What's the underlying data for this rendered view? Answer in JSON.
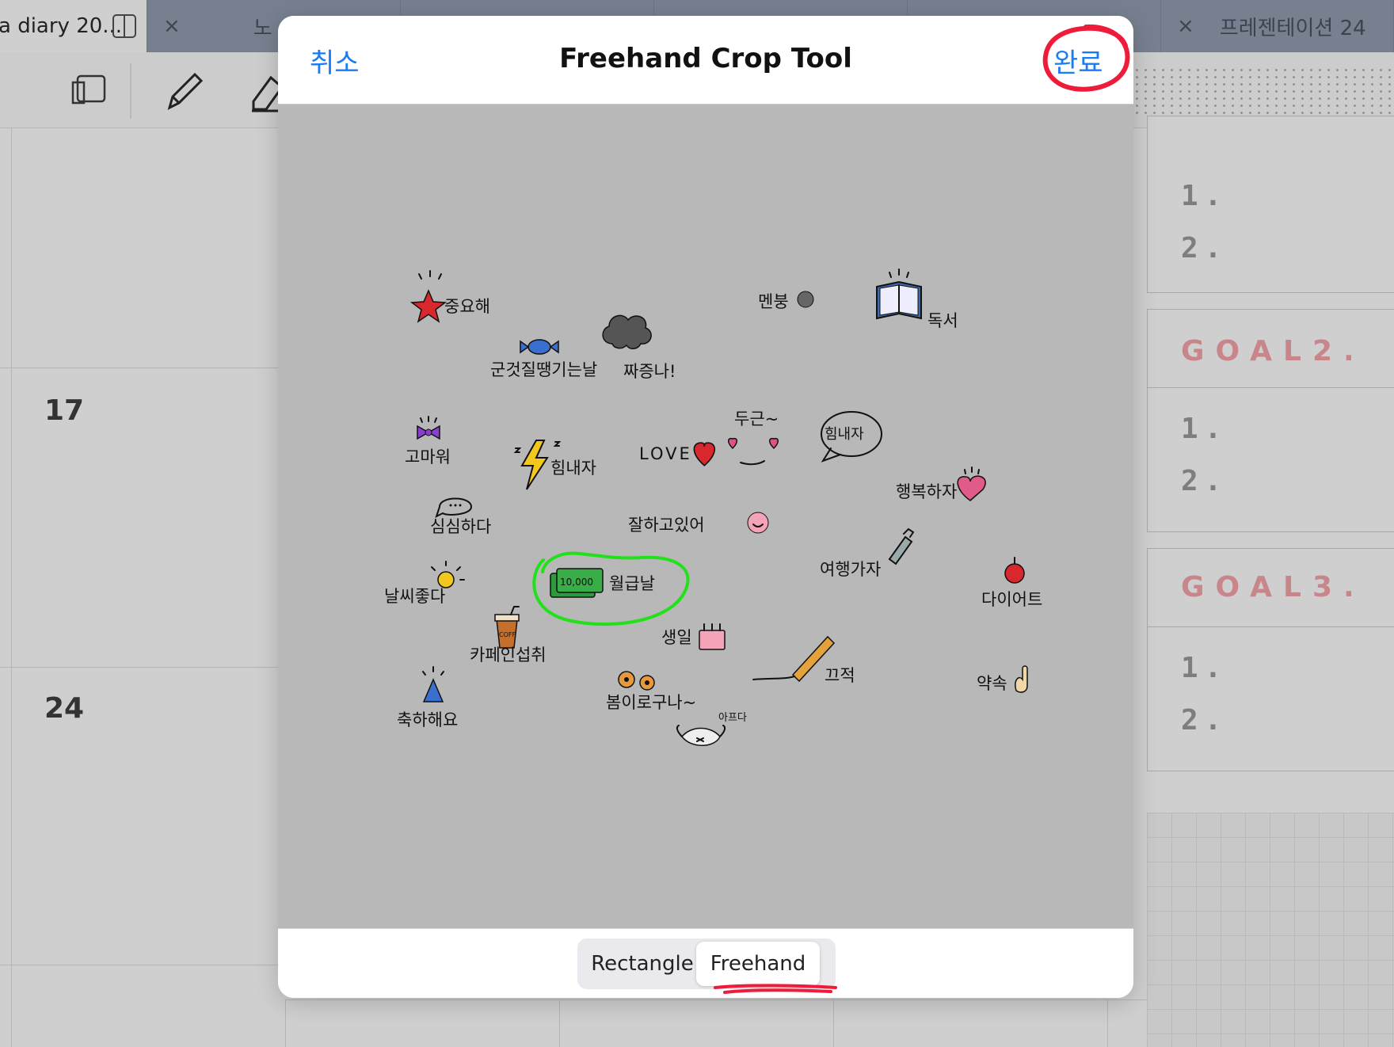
{
  "tabs": [
    {
      "label": "a diary 20...",
      "active": true
    },
    {
      "label": "노",
      "active": false
    },
    {
      "label": "",
      "active": false
    },
    {
      "label": "",
      "active": false
    },
    {
      "label": "",
      "active": false
    },
    {
      "label": "프레젠테이션 24",
      "active": false
    }
  ],
  "tab_close_glyph": "×",
  "toolbar_icons": [
    "page-layout-icon",
    "pencil-icon",
    "eraser-icon"
  ],
  "calendar": {
    "days": [
      "17",
      "24"
    ]
  },
  "goals": {
    "goal2_title": "GOAL2.",
    "goal3_title": "GOAL3.",
    "item1": "1.",
    "item2": "2."
  },
  "modal": {
    "title": "Freehand Crop Tool",
    "cancel_label": "취소",
    "done_label": "완료",
    "modes": [
      "Rectangle",
      "Freehand"
    ],
    "selected_mode": "Freehand"
  },
  "stickers": [
    {
      "text": "중요해",
      "icon": "star-icon"
    },
    {
      "text": "군것질땡기는날",
      "icon": "candy-icon"
    },
    {
      "text": "짜증나!",
      "icon": "cloud-icon"
    },
    {
      "text": "멘붕",
      "icon": "smoke-icon"
    },
    {
      "text": "독서",
      "icon": "book-icon"
    },
    {
      "text": "고마워",
      "icon": "ribbon-icon"
    },
    {
      "text": "힘내자",
      "icon": "lightning-icon"
    },
    {
      "text": "LOVE",
      "icon": "heart-icon"
    },
    {
      "text": "두근~",
      "icon": "hearts-icon"
    },
    {
      "text": "힘내자",
      "icon": "speech-bubble-icon"
    },
    {
      "text": "행복하자",
      "icon": "heart-face-icon"
    },
    {
      "text": "심심하다",
      "icon": "dots-bubble-icon"
    },
    {
      "text": "잘하고있어",
      "icon": "smile-icon"
    },
    {
      "text": "10,000",
      "icon": "money-icon"
    },
    {
      "text": "월급날",
      "icon": "money-icon"
    },
    {
      "text": "여행가자",
      "icon": "bottle-icon"
    },
    {
      "text": "다이어트",
      "icon": "apple-icon"
    },
    {
      "text": "날씨좋다",
      "icon": "sun-icon"
    },
    {
      "text": "카페인섭취",
      "icon": "coffee-icon"
    },
    {
      "text": "COFF",
      "icon": "coffee-icon"
    },
    {
      "text": "생일",
      "icon": "cake-icon"
    },
    {
      "text": "끄적",
      "icon": "pencil-icon"
    },
    {
      "text": "약속",
      "icon": "pinky-icon"
    },
    {
      "text": "축하해요",
      "icon": "party-hat-icon"
    },
    {
      "text": "봄이로구나~",
      "icon": "flower-icon"
    },
    {
      "text": "아프다",
      "icon": "mask-icon"
    }
  ],
  "colors": {
    "accent": "#1a7cf5",
    "annotation_red": "#ee1c3a",
    "annotation_green": "#22e01a",
    "goal_text": "#c8858a"
  }
}
